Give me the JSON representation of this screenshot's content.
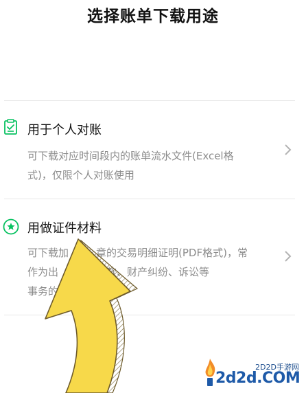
{
  "header": {
    "title": "选择账单下载用途"
  },
  "options": [
    {
      "title": "用于个人对账",
      "desc_line1": "可下载对应时间段内的账单流水文件(Excel格",
      "desc_line2": "式)，仅限个人对账使用",
      "icon": "checklist-icon",
      "chevron": "chevron-right-icon"
    },
    {
      "title": "用做证件材料",
      "desc_line1": "可下载加",
      "desc_line1b": "章的交易明细证明(PDF格式)，常",
      "desc_line2": "作为出",
      "desc_line2b": "行贷款、财产纠纷、诉讼等",
      "desc_line3": "事务的",
      "icon": "star-badge-icon",
      "chevron": "chevron-right-icon"
    }
  ],
  "overlay": {
    "icon": "yellow-arrow-up-icon",
    "color": "#f7d94a"
  },
  "watermark": {
    "subtitle": "2D2D手游网",
    "main": "2d2d.COM"
  },
  "colors": {
    "accent_green": "#07c160",
    "text_gray": "#8c8c8c",
    "divider": "#e6e6e6"
  }
}
